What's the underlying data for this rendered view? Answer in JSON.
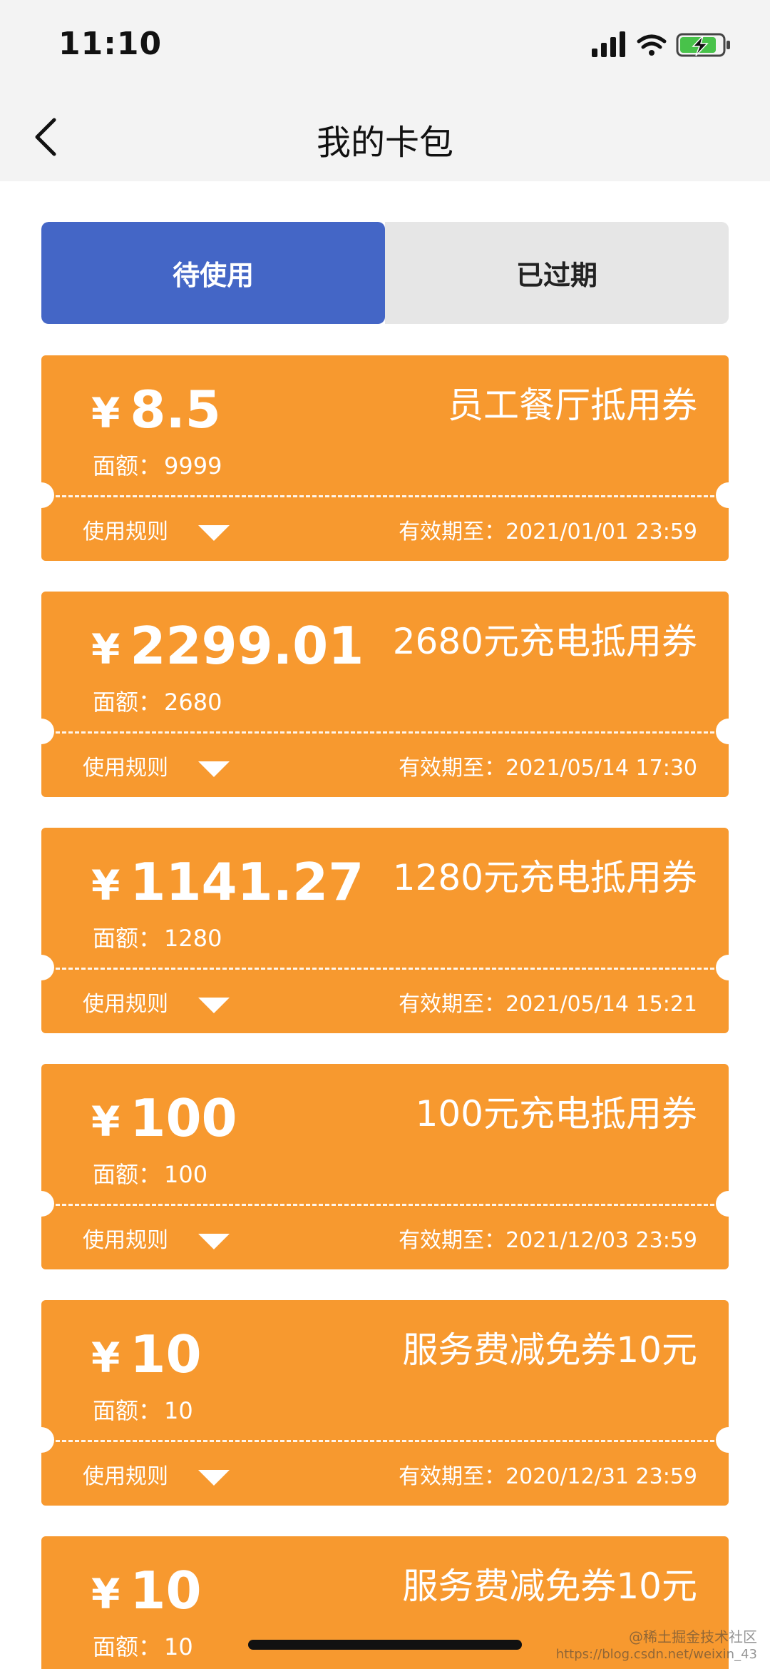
{
  "status_bar": {
    "time": "11:10",
    "icons": [
      "signal-icon",
      "wifi-icon",
      "battery-charging-icon"
    ]
  },
  "nav": {
    "back_icon": "chevron-left-icon",
    "title": "我的卡包"
  },
  "tabs": [
    {
      "label": "待使用",
      "active": true
    },
    {
      "label": "已过期",
      "active": false
    }
  ],
  "cards": [
    {
      "currency": "¥",
      "amount": "8.5",
      "title": "员工餐厅抵用券",
      "face_label": "面额：",
      "face_value": "9999",
      "rules_label": "使用规则",
      "expiry_label": "有效期至：",
      "expiry": "2021/01/01 23:59"
    },
    {
      "currency": "¥",
      "amount": "2299.01",
      "title": "2680元充电抵用券",
      "face_label": "面额：",
      "face_value": "2680",
      "rules_label": "使用规则",
      "expiry_label": "有效期至：",
      "expiry": "2021/05/14 17:30"
    },
    {
      "currency": "¥",
      "amount": "1141.27",
      "title": "1280元充电抵用券",
      "face_label": "面额：",
      "face_value": "1280",
      "rules_label": "使用规则",
      "expiry_label": "有效期至：",
      "expiry": "2021/05/14 15:21"
    },
    {
      "currency": "¥",
      "amount": "100",
      "title": "100元充电抵用券",
      "face_label": "面额：",
      "face_value": "100",
      "rules_label": "使用规则",
      "expiry_label": "有效期至：",
      "expiry": "2021/12/03 23:59"
    },
    {
      "currency": "¥",
      "amount": "10",
      "title": "服务费减免券10元",
      "face_label": "面额：",
      "face_value": "10",
      "rules_label": "使用规则",
      "expiry_label": "有效期至：",
      "expiry": "2020/12/31 23:59"
    },
    {
      "currency": "¥",
      "amount": "10",
      "title": "服务费减免券10元",
      "face_label": "面额：",
      "face_value": "10"
    }
  ],
  "watermark": {
    "line1": "@稀土掘金技术社区",
    "line2": "https://blog.csdn.net/weixin_43"
  },
  "colors": {
    "card": "#f7992f",
    "tab_active": "#4466c6",
    "tab_inactive": "#e6e6e6",
    "header_bg": "#f3f3f3"
  }
}
